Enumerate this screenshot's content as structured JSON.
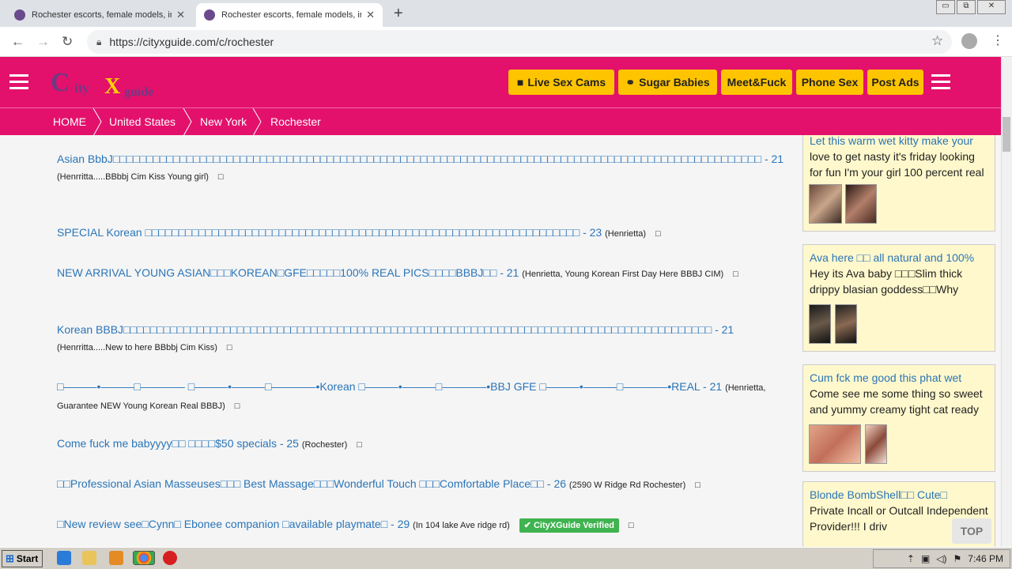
{
  "browser": {
    "tabs": [
      {
        "title": "Rochester escorts, female models, in",
        "active": false
      },
      {
        "title": "Rochester escorts, female models, in",
        "active": true
      }
    ],
    "url": "https://cityxguide.com/c/rochester",
    "window_controls": {
      "minimize": "▭",
      "restore": "⧉",
      "close": "✕"
    }
  },
  "site": {
    "logo": {
      "c": "C",
      "ity": "ity",
      "x": "X",
      "guide": "guide"
    },
    "nav_buttons": [
      {
        "label": "Live Sex Cams",
        "icon": "video-camera-icon"
      },
      {
        "label": "Sugar Babies",
        "icon": "sugar-icon"
      },
      {
        "label": "Meet&Fuck"
      },
      {
        "label": "Phone Sex"
      },
      {
        "label": "Post Ads"
      }
    ],
    "breadcrumb": [
      "HOME",
      "United States",
      "New York",
      "Rochester"
    ]
  },
  "listings": [
    {
      "title": "Asian BbbJ□□□□□□□□□□□□□□□□□□□□□□□□□□□□□□□□□□□□□□□□□□□□□□□□□□□□□□□□□□□□□□□□□□□□□□□□□□□□□□□□□□□□□□□□□□□□□□□□□ - 21",
      "location": "(Henrritta.....BBbbj Cim Kiss Young girl)",
      "mark": "□"
    },
    {
      "title": "SPECIAL Korean □□□□□□□□□□□□□□□□□□□□□□□□□□□□□□□□□□□□□□□□□□□□□□□□□□□□□□□□□□□□□□□□□ - 23",
      "location": "(Henrietta)",
      "mark": "□"
    },
    {
      "title": "NEW ARRIVAL YOUNG ASIAN□□□KOREAN□GFE□□□□□100% REAL PICS□□□□BBBJ□□ - 21",
      "location": "(Henrietta, Young Korean First Day Here BBBJ CIM)",
      "mark": "□"
    },
    {
      "title": "Korean BBBJ□□□□□□□□□□□□□□□□□□□□□□□□□□□□□□□□□□□□□□□□□□□□□□□□□□□□□□□□□□□□□□□□□□□□□□□□□□□□□□□□□□□□□□□□ - 21",
      "location": "(Henrritta.....New to here BBbbj Cim Kiss)",
      "mark": "□"
    },
    {
      "title": "□———•———□———— □———•———□————•Korean □———•———□————•BBJ GFE □———•———□————•REAL - 21",
      "location": "(Henrietta, Guarantee NEW Young Korean Real BBBJ)",
      "mark": "□"
    },
    {
      "title": "Come fuck me babyyyy□□ □□□□$50 specials - 25",
      "location": "(Rochester)",
      "mark": "□"
    },
    {
      "title": "□□Professional Asian Masseuses□□□ Best Massage□□□Wonderful Touch □□□Comfortable Place□□ - 26",
      "location": "(2590 W Ridge Rd Rochester)",
      "mark": "□"
    },
    {
      "title": "□New review see□Cynn□ Ebonee companion □available playmate□ - 29",
      "location": "(In 104 lake Ave ridge rd)",
      "badge": "✔ CityXGuide Verified",
      "mark": "□"
    }
  ],
  "sidebar": [
    {
      "title": "Let this warm wet kitty make your",
      "body": "love to get nasty it's friday looking for fun I'm your girl 100 percent real"
    },
    {
      "title": "Ava here □□ all natural and 100%",
      "body": "Hey its Ava baby □□□Slim thick drippy blasian goddess□□Why"
    },
    {
      "title": "Cum fck me good this phat wet",
      "body": "Come see me some thing so sweet and yummy creamy tight cat ready"
    },
    {
      "title": "Blonde BombShell□□ Cute□",
      "body": "Private Incall or Outcall Independent Provider!!! I driv"
    }
  ],
  "top_button": "TOP",
  "taskbar": {
    "start": "Start",
    "time": "7:46 PM"
  },
  "colors": {
    "brand": "#e3116c",
    "button": "#ffc400",
    "link": "#2a75b8",
    "card": "#fff8cc",
    "verified": "#3fb34f"
  }
}
